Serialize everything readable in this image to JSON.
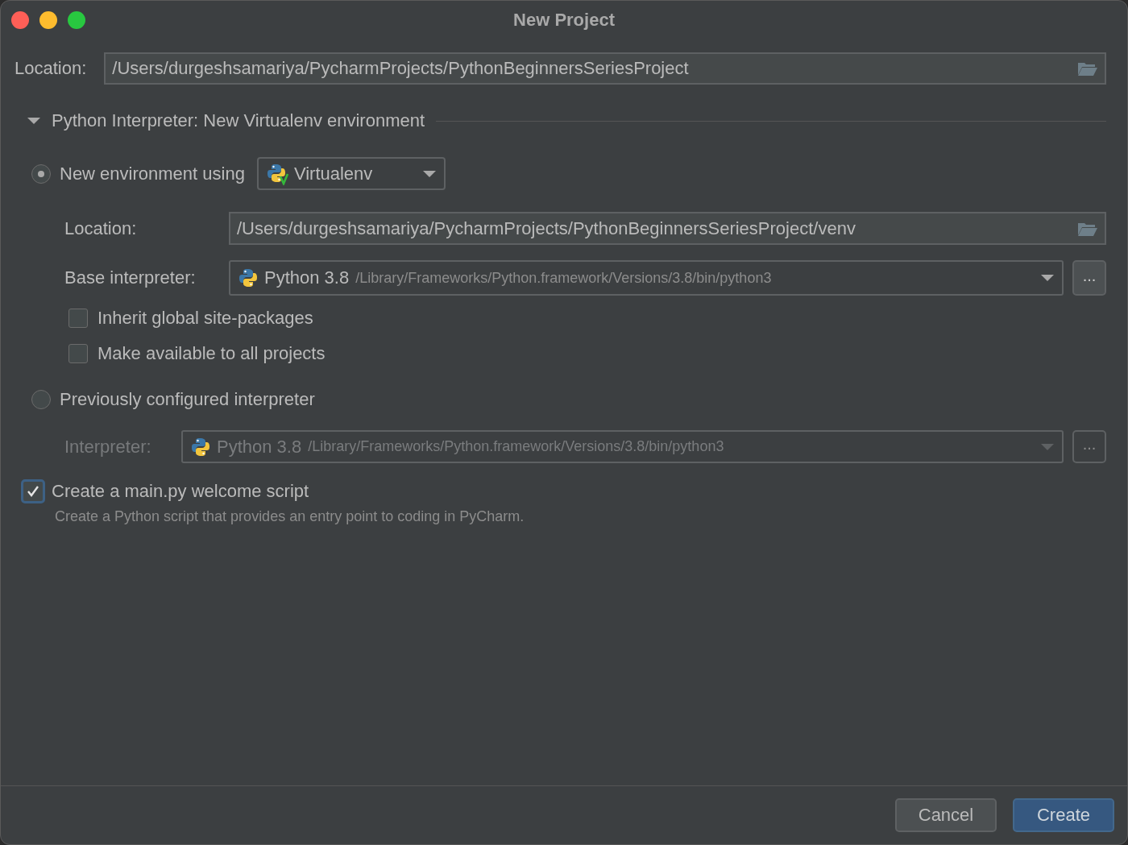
{
  "window": {
    "title": "New Project"
  },
  "location": {
    "label": "Location:",
    "value": "/Users/durgeshsamariya/PycharmProjects/PythonBeginnersSeriesProject"
  },
  "interpreter_section": {
    "title": "Python Interpreter: New Virtualenv environment",
    "expanded": true
  },
  "new_environment": {
    "label": "New environment using",
    "selected": true,
    "tool": "Virtualenv",
    "location": {
      "label": "Location:",
      "value": "/Users/durgeshsamariya/PycharmProjects/PythonBeginnersSeriesProject/venv"
    },
    "base_interpreter": {
      "label": "Base interpreter:",
      "name": "Python 3.8",
      "path": "/Library/Frameworks/Python.framework/Versions/3.8/bin/python3",
      "browse": "..."
    },
    "checkboxes": [
      {
        "label": "Inherit global site-packages",
        "checked": false
      },
      {
        "label": "Make available to all projects",
        "checked": false
      }
    ]
  },
  "previous_interpreter": {
    "label": "Previously configured interpreter",
    "selected": false,
    "interpreter": {
      "label": "Interpreter:",
      "name": "Python 3.8",
      "path": "/Library/Frameworks/Python.framework/Versions/3.8/bin/python3",
      "browse": "...",
      "disabled": true
    }
  },
  "welcome_script": {
    "label": "Create a main.py welcome script",
    "checked": true,
    "description": "Create a Python script that provides an entry point to coding in PyCharm."
  },
  "buttons": [
    {
      "label": "Cancel",
      "kind": "secondary"
    },
    {
      "label": "Create",
      "kind": "primary"
    }
  ]
}
